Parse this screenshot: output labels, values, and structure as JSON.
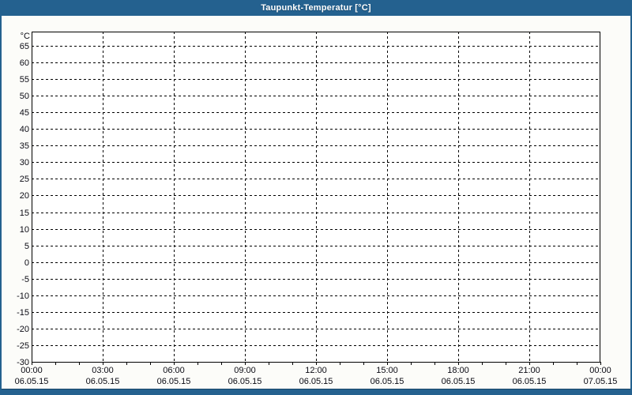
{
  "window": {
    "title": "Taupunkt-Temperatur [°C]"
  },
  "colors": {
    "frame": "#24618f",
    "title_text": "#ffffff",
    "content_bg": "#fcfcf9",
    "plot_bg": "#ffffff",
    "grid": "#000000",
    "axis": "#000000",
    "tick_text": "#0b0b14"
  },
  "chart_data": {
    "type": "line",
    "title": "Taupunkt-Temperatur [°C]",
    "ylabel": "°C",
    "xlabel": "",
    "ylim": [
      -30,
      69
    ],
    "y_tick_step": 5,
    "y_ticks": [
      65,
      60,
      55,
      50,
      45,
      40,
      35,
      30,
      25,
      20,
      15,
      10,
      5,
      0,
      -5,
      -10,
      -15,
      -20,
      -25,
      -30
    ],
    "x_range_hours": [
      0,
      24
    ],
    "x_major_tick_interval_hours": 3,
    "x_minor_tick_interval_hours": 1,
    "x_ticks": [
      {
        "time": "00:00",
        "date": "06.05.15"
      },
      {
        "time": "03:00",
        "date": "06.05.15"
      },
      {
        "time": "06:00",
        "date": "06.05.15"
      },
      {
        "time": "09:00",
        "date": "06.05.15"
      },
      {
        "time": "12:00",
        "date": "06.05.15"
      },
      {
        "time": "15:00",
        "date": "06.05.15"
      },
      {
        "time": "18:00",
        "date": "06.05.15"
      },
      {
        "time": "21:00",
        "date": "06.05.15"
      },
      {
        "time": "00:00",
        "date": "07.05.15"
      }
    ],
    "grid_style": "dashed",
    "legend": "none",
    "series": []
  }
}
